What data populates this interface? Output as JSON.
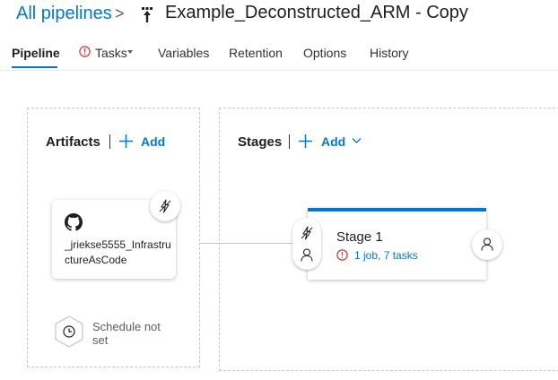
{
  "header": {
    "breadcrumb_root": "All pipelines",
    "breadcrumb_separator": ">",
    "title": "Example_Deconstructed_ARM - Copy"
  },
  "tabs": [
    {
      "label": "Pipeline",
      "active": true
    },
    {
      "label": "Tasks",
      "has_warning": true,
      "has_dropdown": true
    },
    {
      "label": "Variables"
    },
    {
      "label": "Retention"
    },
    {
      "label": "Options"
    },
    {
      "label": "History"
    }
  ],
  "artifacts": {
    "title": "Artifacts",
    "add_label": "Add",
    "items": [
      {
        "name": "_jriekse5555_InfrastructureAsCode",
        "source_icon": "github-icon",
        "trigger_icon": "lightning-icon"
      }
    ],
    "schedule": {
      "label": "Schedule not set",
      "icon": "clock-icon"
    }
  },
  "stages": {
    "title": "Stages",
    "add_label": "Add",
    "items": [
      {
        "name": "Stage 1",
        "summary": "1 job, 7 tasks",
        "status_icon": "warning-icon"
      }
    ]
  },
  "colors": {
    "accent": "#0078d4",
    "warning": "#d13438",
    "border": "#c8c6c4"
  }
}
